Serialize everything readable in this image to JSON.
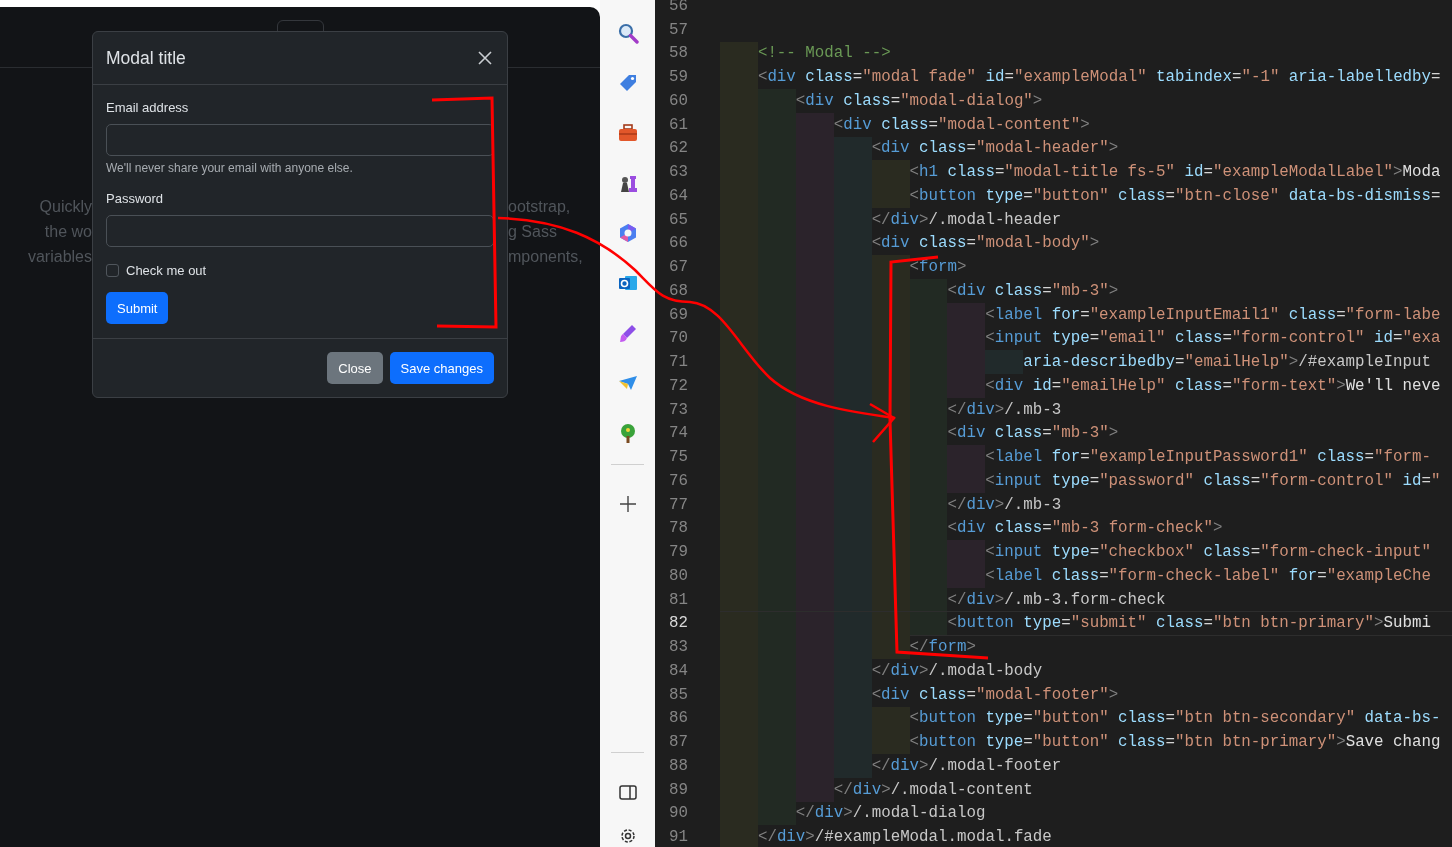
{
  "browser_preview": {
    "hero_left": [
      "Quickly",
      "the wo",
      "variables"
    ],
    "hero_right": [
      "ootstrap,",
      "g Sass",
      "mponents,"
    ]
  },
  "modal": {
    "title": "Modal title",
    "fields": [
      {
        "label": "Email address",
        "help": "We'll never share your email with anyone else."
      },
      {
        "label": "Password"
      }
    ],
    "checkbox": {
      "label": "Check me out",
      "checked": false
    },
    "submit": {
      "label": "Submit",
      "kind": "primary"
    },
    "footer_buttons": [
      {
        "label": "Close",
        "kind": "secondary"
      },
      {
        "label": "Save changes",
        "kind": "primary"
      }
    ]
  },
  "editor": {
    "lines": [
      {
        "number": "56",
        "current": false
      },
      {
        "number": "57",
        "current": false
      },
      {
        "number": "58",
        "current": false,
        "tokens": [
          {
            "kind": "comment",
            "text": "    <!-- Modal -->"
          }
        ]
      },
      {
        "number": "59",
        "current": false,
        "tokens": [
          {
            "kind": "punct",
            "text": "    <"
          },
          {
            "kind": "tag",
            "text": "div"
          },
          {
            "kind": "attr",
            "text": " class"
          },
          {
            "kind": "op",
            "text": "="
          },
          {
            "kind": "str",
            "text": "\"modal fade\""
          },
          {
            "kind": "attr",
            "text": " id"
          },
          {
            "kind": "op",
            "text": "="
          },
          {
            "kind": "str",
            "text": "\"exampleModal\""
          },
          {
            "kind": "attr",
            "text": " tabindex"
          },
          {
            "kind": "op",
            "text": "="
          },
          {
            "kind": "str",
            "text": "\"-1\""
          },
          {
            "kind": "attr",
            "text": " aria-labelledby"
          },
          {
            "kind": "op",
            "text": "="
          }
        ]
      },
      {
        "number": "60",
        "current": false,
        "tokens": [
          {
            "kind": "punct",
            "text": "        <"
          },
          {
            "kind": "tag",
            "text": "div"
          },
          {
            "kind": "attr",
            "text": " class"
          },
          {
            "kind": "op",
            "text": "="
          },
          {
            "kind": "str",
            "text": "\"modal-dialog\""
          },
          {
            "kind": "punct",
            "text": ">"
          }
        ]
      },
      {
        "number": "61",
        "current": false,
        "tokens": [
          {
            "kind": "punct",
            "text": "            <"
          },
          {
            "kind": "tag",
            "text": "div"
          },
          {
            "kind": "attr",
            "text": " class"
          },
          {
            "kind": "op",
            "text": "="
          },
          {
            "kind": "str",
            "text": "\"modal-content\""
          },
          {
            "kind": "punct",
            "text": ">"
          }
        ]
      },
      {
        "number": "62",
        "current": false,
        "tokens": [
          {
            "kind": "punct",
            "text": "                <"
          },
          {
            "kind": "tag",
            "text": "div"
          },
          {
            "kind": "attr",
            "text": " class"
          },
          {
            "kind": "op",
            "text": "="
          },
          {
            "kind": "str",
            "text": "\"modal-header\""
          },
          {
            "kind": "punct",
            "text": ">"
          }
        ]
      },
      {
        "number": "63",
        "current": false,
        "tokens": [
          {
            "kind": "punct",
            "text": "                    <"
          },
          {
            "kind": "tag",
            "text": "h1"
          },
          {
            "kind": "attr",
            "text": " class"
          },
          {
            "kind": "op",
            "text": "="
          },
          {
            "kind": "str",
            "text": "\"modal-title fs-5\""
          },
          {
            "kind": "attr",
            "text": " id"
          },
          {
            "kind": "op",
            "text": "="
          },
          {
            "kind": "str",
            "text": "\"exampleModalLabel\""
          },
          {
            "kind": "punct",
            "text": ">"
          },
          {
            "kind": "plain",
            "text": "Moda"
          }
        ]
      },
      {
        "number": "64",
        "current": false,
        "tokens": [
          {
            "kind": "punct",
            "text": "                    <"
          },
          {
            "kind": "tag",
            "text": "button"
          },
          {
            "kind": "attr",
            "text": " type"
          },
          {
            "kind": "op",
            "text": "="
          },
          {
            "kind": "str",
            "text": "\"button\""
          },
          {
            "kind": "attr",
            "text": " class"
          },
          {
            "kind": "op",
            "text": "="
          },
          {
            "kind": "str",
            "text": "\"btn-close\""
          },
          {
            "kind": "attr",
            "text": " data-bs-dismiss"
          },
          {
            "kind": "op",
            "text": "="
          }
        ]
      },
      {
        "number": "65",
        "current": false,
        "tokens": [
          {
            "kind": "punct",
            "text": "                </"
          },
          {
            "kind": "tag",
            "text": "div"
          },
          {
            "kind": "punct",
            "text": ">"
          },
          {
            "kind": "note",
            "text": "/.modal-header"
          }
        ]
      },
      {
        "number": "66",
        "current": false,
        "tokens": [
          {
            "kind": "punct",
            "text": "                <"
          },
          {
            "kind": "tag",
            "text": "div"
          },
          {
            "kind": "attr",
            "text": " class"
          },
          {
            "kind": "op",
            "text": "="
          },
          {
            "kind": "str",
            "text": "\"modal-body\""
          },
          {
            "kind": "punct",
            "text": ">"
          }
        ]
      },
      {
        "number": "67",
        "current": false,
        "tokens": [
          {
            "kind": "punct",
            "text": "                    <"
          },
          {
            "kind": "tag",
            "text": "form"
          },
          {
            "kind": "punct",
            "text": ">"
          }
        ]
      },
      {
        "number": "68",
        "current": false,
        "tokens": [
          {
            "kind": "punct",
            "text": "                        <"
          },
          {
            "kind": "tag",
            "text": "div"
          },
          {
            "kind": "attr",
            "text": " class"
          },
          {
            "kind": "op",
            "text": "="
          },
          {
            "kind": "str",
            "text": "\"mb-3\""
          },
          {
            "kind": "punct",
            "text": ">"
          }
        ]
      },
      {
        "number": "69",
        "current": false,
        "tokens": [
          {
            "kind": "punct",
            "text": "                            <"
          },
          {
            "kind": "tag",
            "text": "label"
          },
          {
            "kind": "attr",
            "text": " for"
          },
          {
            "kind": "op",
            "text": "="
          },
          {
            "kind": "str",
            "text": "\"exampleInputEmail1\""
          },
          {
            "kind": "attr",
            "text": " class"
          },
          {
            "kind": "op",
            "text": "="
          },
          {
            "kind": "str",
            "text": "\"form-labe"
          }
        ]
      },
      {
        "number": "70",
        "current": false,
        "tokens": [
          {
            "kind": "punct",
            "text": "                            <"
          },
          {
            "kind": "tag",
            "text": "input"
          },
          {
            "kind": "attr",
            "text": " type"
          },
          {
            "kind": "op",
            "text": "="
          },
          {
            "kind": "str",
            "text": "\"email\""
          },
          {
            "kind": "attr",
            "text": " class"
          },
          {
            "kind": "op",
            "text": "="
          },
          {
            "kind": "str",
            "text": "\"form-control\""
          },
          {
            "kind": "attr",
            "text": " id"
          },
          {
            "kind": "op",
            "text": "="
          },
          {
            "kind": "str",
            "text": "\"exa"
          }
        ]
      },
      {
        "number": "71",
        "current": false,
        "tokens": [
          {
            "kind": "attr",
            "text": "                                aria-describedby"
          },
          {
            "kind": "op",
            "text": "="
          },
          {
            "kind": "str",
            "text": "\"emailHelp\""
          },
          {
            "kind": "punct",
            "text": ">"
          },
          {
            "kind": "note",
            "text": "/#exampleInput"
          }
        ]
      },
      {
        "number": "72",
        "current": false,
        "tokens": [
          {
            "kind": "punct",
            "text": "                            <"
          },
          {
            "kind": "tag",
            "text": "div"
          },
          {
            "kind": "attr",
            "text": " id"
          },
          {
            "kind": "op",
            "text": "="
          },
          {
            "kind": "str",
            "text": "\"emailHelp\""
          },
          {
            "kind": "attr",
            "text": " class"
          },
          {
            "kind": "op",
            "text": "="
          },
          {
            "kind": "str",
            "text": "\"form-text\""
          },
          {
            "kind": "punct",
            "text": ">"
          },
          {
            "kind": "plain",
            "text": "We'll neve"
          }
        ]
      },
      {
        "number": "73",
        "current": false,
        "tokens": [
          {
            "kind": "punct",
            "text": "                        </"
          },
          {
            "kind": "tag",
            "text": "div"
          },
          {
            "kind": "punct",
            "text": ">"
          },
          {
            "kind": "note",
            "text": "/.mb-3"
          }
        ]
      },
      {
        "number": "74",
        "current": false,
        "tokens": [
          {
            "kind": "punct",
            "text": "                        <"
          },
          {
            "kind": "tag",
            "text": "div"
          },
          {
            "kind": "attr",
            "text": " class"
          },
          {
            "kind": "op",
            "text": "="
          },
          {
            "kind": "str",
            "text": "\"mb-3\""
          },
          {
            "kind": "punct",
            "text": ">"
          }
        ]
      },
      {
        "number": "75",
        "current": false,
        "tokens": [
          {
            "kind": "punct",
            "text": "                            <"
          },
          {
            "kind": "tag",
            "text": "label"
          },
          {
            "kind": "attr",
            "text": " for"
          },
          {
            "kind": "op",
            "text": "="
          },
          {
            "kind": "str",
            "text": "\"exampleInputPassword1\""
          },
          {
            "kind": "attr",
            "text": " class"
          },
          {
            "kind": "op",
            "text": "="
          },
          {
            "kind": "str",
            "text": "\"form-"
          }
        ]
      },
      {
        "number": "76",
        "current": false,
        "tokens": [
          {
            "kind": "punct",
            "text": "                            <"
          },
          {
            "kind": "tag",
            "text": "input"
          },
          {
            "kind": "attr",
            "text": " type"
          },
          {
            "kind": "op",
            "text": "="
          },
          {
            "kind": "str",
            "text": "\"password\""
          },
          {
            "kind": "attr",
            "text": " class"
          },
          {
            "kind": "op",
            "text": "="
          },
          {
            "kind": "str",
            "text": "\"form-control\""
          },
          {
            "kind": "attr",
            "text": " id"
          },
          {
            "kind": "op",
            "text": "="
          },
          {
            "kind": "str",
            "text": "\""
          }
        ]
      },
      {
        "number": "77",
        "current": false,
        "tokens": [
          {
            "kind": "punct",
            "text": "                        </"
          },
          {
            "kind": "tag",
            "text": "div"
          },
          {
            "kind": "punct",
            "text": ">"
          },
          {
            "kind": "note",
            "text": "/.mb-3"
          }
        ]
      },
      {
        "number": "78",
        "current": false,
        "tokens": [
          {
            "kind": "punct",
            "text": "                        <"
          },
          {
            "kind": "tag",
            "text": "div"
          },
          {
            "kind": "attr",
            "text": " class"
          },
          {
            "kind": "op",
            "text": "="
          },
          {
            "kind": "str",
            "text": "\"mb-3 form-check\""
          },
          {
            "kind": "punct",
            "text": ">"
          }
        ]
      },
      {
        "number": "79",
        "current": false,
        "tokens": [
          {
            "kind": "punct",
            "text": "                            <"
          },
          {
            "kind": "tag",
            "text": "input"
          },
          {
            "kind": "attr",
            "text": " type"
          },
          {
            "kind": "op",
            "text": "="
          },
          {
            "kind": "str",
            "text": "\"checkbox\""
          },
          {
            "kind": "attr",
            "text": " class"
          },
          {
            "kind": "op",
            "text": "="
          },
          {
            "kind": "str",
            "text": "\"form-check-input\""
          }
        ]
      },
      {
        "number": "80",
        "current": false,
        "tokens": [
          {
            "kind": "punct",
            "text": "                            <"
          },
          {
            "kind": "tag",
            "text": "label"
          },
          {
            "kind": "attr",
            "text": " class"
          },
          {
            "kind": "op",
            "text": "="
          },
          {
            "kind": "str",
            "text": "\"form-check-label\""
          },
          {
            "kind": "attr",
            "text": " for"
          },
          {
            "kind": "op",
            "text": "="
          },
          {
            "kind": "str",
            "text": "\"exampleChe"
          }
        ]
      },
      {
        "number": "81",
        "current": false,
        "tokens": [
          {
            "kind": "punct",
            "text": "                        </"
          },
          {
            "kind": "tag",
            "text": "div"
          },
          {
            "kind": "punct",
            "text": ">"
          },
          {
            "kind": "note",
            "text": "/.mb-3.form-check"
          }
        ]
      },
      {
        "number": "82",
        "current": true,
        "tokens": [
          {
            "kind": "punct",
            "text": "                        <"
          },
          {
            "kind": "tag",
            "text": "button"
          },
          {
            "kind": "attr",
            "text": " type"
          },
          {
            "kind": "op",
            "text": "="
          },
          {
            "kind": "str",
            "text": "\"submit\""
          },
          {
            "kind": "attr",
            "text": " class"
          },
          {
            "kind": "op",
            "text": "="
          },
          {
            "kind": "str",
            "text": "\"btn btn-primary\""
          },
          {
            "kind": "punct",
            "text": ">"
          },
          {
            "kind": "plain",
            "text": "Submi"
          }
        ]
      },
      {
        "number": "83",
        "current": false,
        "tokens": [
          {
            "kind": "punct",
            "text": "                    </"
          },
          {
            "kind": "tag",
            "text": "form"
          },
          {
            "kind": "punct",
            "text": ">"
          }
        ]
      },
      {
        "number": "84",
        "current": false,
        "tokens": [
          {
            "kind": "punct",
            "text": "                </"
          },
          {
            "kind": "tag",
            "text": "div"
          },
          {
            "kind": "punct",
            "text": ">"
          },
          {
            "kind": "note",
            "text": "/.modal-body"
          }
        ]
      },
      {
        "number": "85",
        "current": false,
        "tokens": [
          {
            "kind": "punct",
            "text": "                <"
          },
          {
            "kind": "tag",
            "text": "div"
          },
          {
            "kind": "attr",
            "text": " class"
          },
          {
            "kind": "op",
            "text": "="
          },
          {
            "kind": "str",
            "text": "\"modal-footer\""
          },
          {
            "kind": "punct",
            "text": ">"
          }
        ]
      },
      {
        "number": "86",
        "current": false,
        "tokens": [
          {
            "kind": "punct",
            "text": "                    <"
          },
          {
            "kind": "tag",
            "text": "button"
          },
          {
            "kind": "attr",
            "text": " type"
          },
          {
            "kind": "op",
            "text": "="
          },
          {
            "kind": "str",
            "text": "\"button\""
          },
          {
            "kind": "attr",
            "text": " class"
          },
          {
            "kind": "op",
            "text": "="
          },
          {
            "kind": "str",
            "text": "\"btn btn-secondary\""
          },
          {
            "kind": "attr",
            "text": " data-bs-"
          }
        ]
      },
      {
        "number": "87",
        "current": false,
        "tokens": [
          {
            "kind": "punct",
            "text": "                    <"
          },
          {
            "kind": "tag",
            "text": "button"
          },
          {
            "kind": "attr",
            "text": " type"
          },
          {
            "kind": "op",
            "text": "="
          },
          {
            "kind": "str",
            "text": "\"button\""
          },
          {
            "kind": "attr",
            "text": " class"
          },
          {
            "kind": "op",
            "text": "="
          },
          {
            "kind": "str",
            "text": "\"btn btn-primary\""
          },
          {
            "kind": "punct",
            "text": ">"
          },
          {
            "kind": "plain",
            "text": "Save chang"
          }
        ]
      },
      {
        "number": "88",
        "current": false,
        "tokens": [
          {
            "kind": "punct",
            "text": "                </"
          },
          {
            "kind": "tag",
            "text": "div"
          },
          {
            "kind": "punct",
            "text": ">"
          },
          {
            "kind": "note",
            "text": "/.modal-footer"
          }
        ]
      },
      {
        "number": "89",
        "current": false,
        "tokens": [
          {
            "kind": "punct",
            "text": "            </"
          },
          {
            "kind": "tag",
            "text": "div"
          },
          {
            "kind": "punct",
            "text": ">"
          },
          {
            "kind": "note",
            "text": "/.modal-content"
          }
        ]
      },
      {
        "number": "90",
        "current": false,
        "tokens": [
          {
            "kind": "punct",
            "text": "        </"
          },
          {
            "kind": "tag",
            "text": "div"
          },
          {
            "kind": "punct",
            "text": ">"
          },
          {
            "kind": "note",
            "text": "/.modal-dialog"
          }
        ]
      },
      {
        "number": "91",
        "current": false,
        "tokens": [
          {
            "kind": "punct",
            "text": "    </"
          },
          {
            "kind": "tag",
            "text": "div"
          },
          {
            "kind": "punct",
            "text": ">"
          },
          {
            "kind": "note",
            "text": "/#exampleModal.modal.fade"
          }
        ]
      }
    ]
  }
}
